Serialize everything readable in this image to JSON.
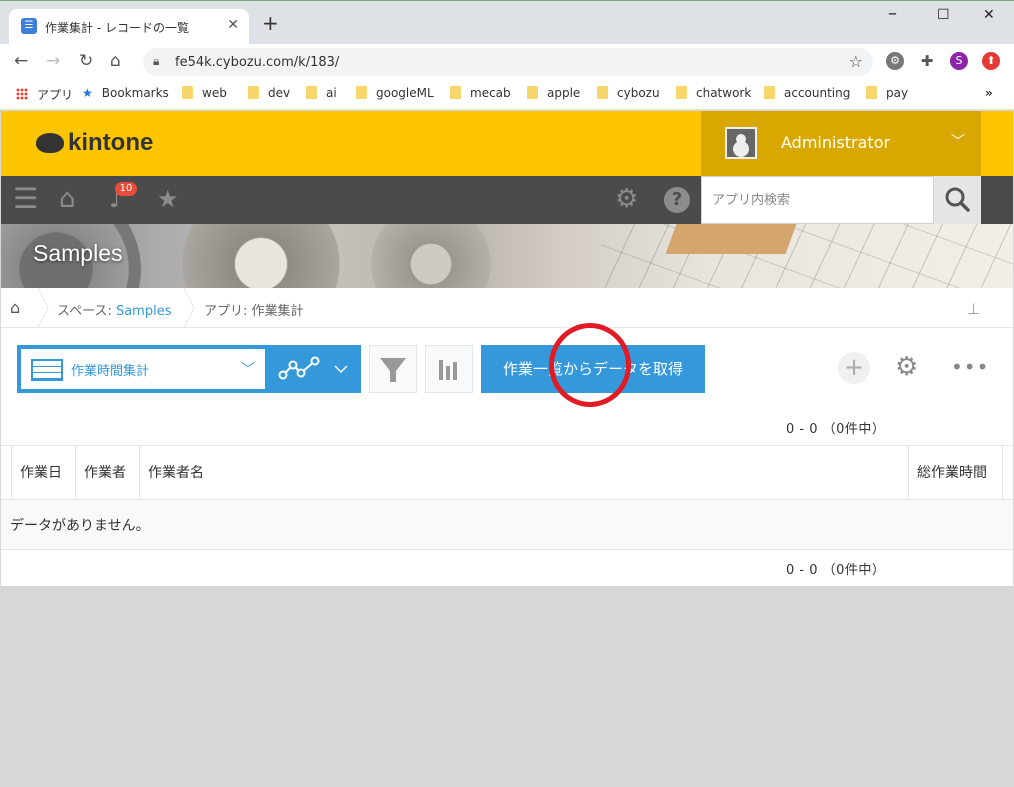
{
  "browser": {
    "tab_title": "作業集計 - レコードの一覧",
    "url": "fe54k.cybozu.com/k/183/",
    "profile_initial": "S",
    "bookmarks": [
      "アプリ",
      "Bookmarks",
      "web",
      "dev",
      "ai",
      "googleML",
      "mecab",
      "apple",
      "cybozu",
      "chatwork",
      "accounting",
      "pay"
    ]
  },
  "header": {
    "logo": "kintone",
    "user_name": "Administrator",
    "notification_count": "10",
    "search_placeholder": "アプリ内検索"
  },
  "banner": {
    "title": "Samples"
  },
  "breadcrumb": {
    "space_prefix": "スペース: ",
    "space_name": "Samples",
    "app": "アプリ: 作業集計"
  },
  "toolbar": {
    "view_name": "作業時間集計",
    "action_label": "作業一覧からデータを取得"
  },
  "pager": {
    "top": "0 - 0 （0件中）",
    "bottom": "0 - 0 （0件中）"
  },
  "table": {
    "columns": [
      "作業日",
      "作業者",
      "作業者名",
      "総作業時間"
    ],
    "empty_message": "データがありません。"
  },
  "colors": {
    "brand_yellow": "#fdc500",
    "accent_blue": "#3498db",
    "annotation_red": "#e01b24"
  }
}
